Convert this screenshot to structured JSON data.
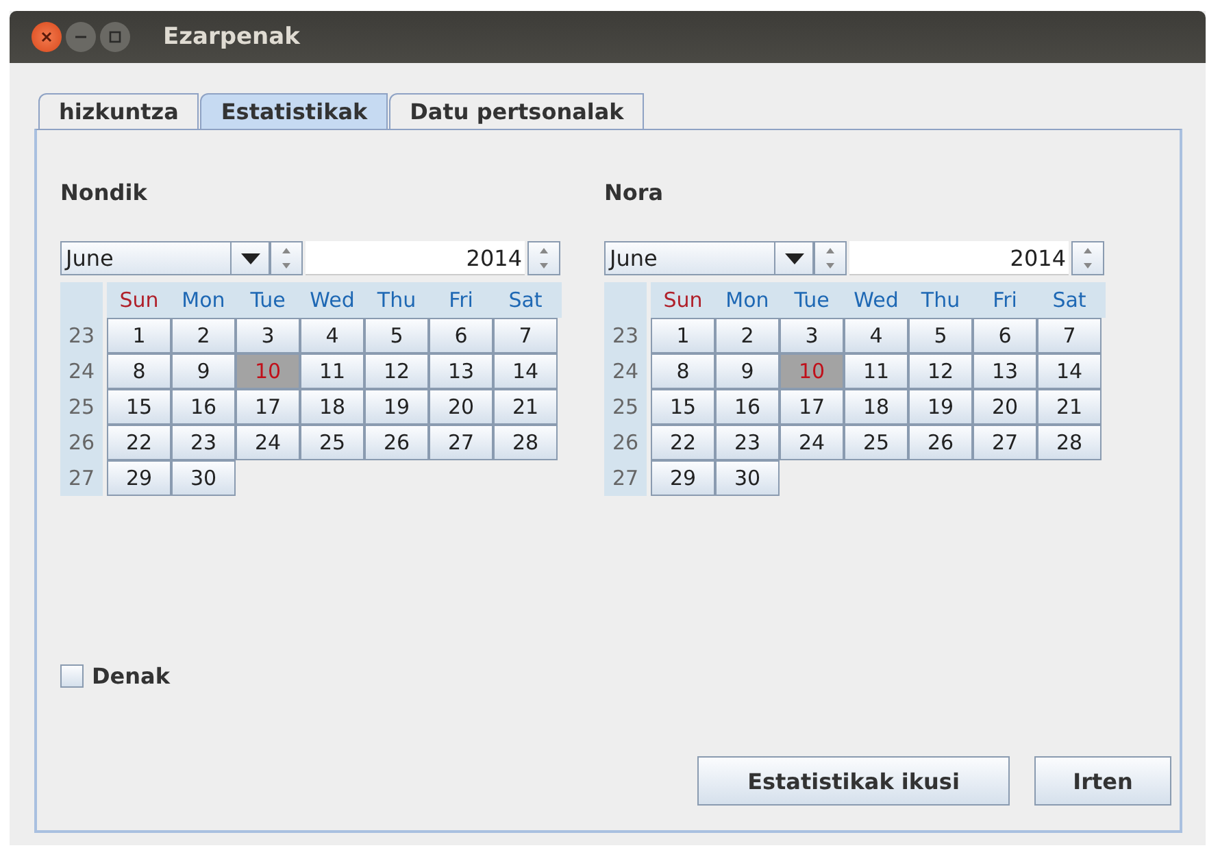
{
  "window": {
    "title": "Ezarpenak"
  },
  "tabs": [
    {
      "label": "hizkuntza",
      "selected": false
    },
    {
      "label": "Estatistikak",
      "selected": true
    },
    {
      "label": "Datu pertsonalak",
      "selected": false
    }
  ],
  "calendars": [
    {
      "title": "Nondik",
      "month": "June",
      "year": "2014",
      "day_names": [
        {
          "label": "Sun",
          "kind": "weekend"
        },
        {
          "label": "Mon",
          "kind": "weekday"
        },
        {
          "label": "Tue",
          "kind": "weekday"
        },
        {
          "label": "Wed",
          "kind": "weekday"
        },
        {
          "label": "Thu",
          "kind": "weekday"
        },
        {
          "label": "Fri",
          "kind": "weekday"
        },
        {
          "label": "Sat",
          "kind": "weekday"
        }
      ],
      "weeks": [
        {
          "week": "23",
          "days": [
            {
              "label": "1",
              "selected": false
            },
            {
              "label": "2",
              "selected": false
            },
            {
              "label": "3",
              "selected": false
            },
            {
              "label": "4",
              "selected": false
            },
            {
              "label": "5",
              "selected": false
            },
            {
              "label": "6",
              "selected": false
            },
            {
              "label": "7",
              "selected": false
            }
          ]
        },
        {
          "week": "24",
          "days": [
            {
              "label": "8",
              "selected": false
            },
            {
              "label": "9",
              "selected": false
            },
            {
              "label": "10",
              "selected": true
            },
            {
              "label": "11",
              "selected": false
            },
            {
              "label": "12",
              "selected": false
            },
            {
              "label": "13",
              "selected": false
            },
            {
              "label": "14",
              "selected": false
            }
          ]
        },
        {
          "week": "25",
          "days": [
            {
              "label": "15",
              "selected": false
            },
            {
              "label": "16",
              "selected": false
            },
            {
              "label": "17",
              "selected": false
            },
            {
              "label": "18",
              "selected": false
            },
            {
              "label": "19",
              "selected": false
            },
            {
              "label": "20",
              "selected": false
            },
            {
              "label": "21",
              "selected": false
            }
          ]
        },
        {
          "week": "26",
          "days": [
            {
              "label": "22",
              "selected": false
            },
            {
              "label": "23",
              "selected": false
            },
            {
              "label": "24",
              "selected": false
            },
            {
              "label": "25",
              "selected": false
            },
            {
              "label": "26",
              "selected": false
            },
            {
              "label": "27",
              "selected": false
            },
            {
              "label": "28",
              "selected": false
            }
          ]
        },
        {
          "week": "27",
          "days": [
            {
              "label": "29",
              "selected": false
            },
            {
              "label": "30",
              "selected": false
            }
          ]
        }
      ]
    },
    {
      "title": "Nora",
      "month": "June",
      "year": "2014",
      "day_names": [
        {
          "label": "Sun",
          "kind": "weekend"
        },
        {
          "label": "Mon",
          "kind": "weekday"
        },
        {
          "label": "Tue",
          "kind": "weekday"
        },
        {
          "label": "Wed",
          "kind": "weekday"
        },
        {
          "label": "Thu",
          "kind": "weekday"
        },
        {
          "label": "Fri",
          "kind": "weekday"
        },
        {
          "label": "Sat",
          "kind": "weekday"
        }
      ],
      "weeks": [
        {
          "week": "23",
          "days": [
            {
              "label": "1",
              "selected": false
            },
            {
              "label": "2",
              "selected": false
            },
            {
              "label": "3",
              "selected": false
            },
            {
              "label": "4",
              "selected": false
            },
            {
              "label": "5",
              "selected": false
            },
            {
              "label": "6",
              "selected": false
            },
            {
              "label": "7",
              "selected": false
            }
          ]
        },
        {
          "week": "24",
          "days": [
            {
              "label": "8",
              "selected": false
            },
            {
              "label": "9",
              "selected": false
            },
            {
              "label": "10",
              "selected": true
            },
            {
              "label": "11",
              "selected": false
            },
            {
              "label": "12",
              "selected": false
            },
            {
              "label": "13",
              "selected": false
            },
            {
              "label": "14",
              "selected": false
            }
          ]
        },
        {
          "week": "25",
          "days": [
            {
              "label": "15",
              "selected": false
            },
            {
              "label": "16",
              "selected": false
            },
            {
              "label": "17",
              "selected": false
            },
            {
              "label": "18",
              "selected": false
            },
            {
              "label": "19",
              "selected": false
            },
            {
              "label": "20",
              "selected": false
            },
            {
              "label": "21",
              "selected": false
            }
          ]
        },
        {
          "week": "26",
          "days": [
            {
              "label": "22",
              "selected": false
            },
            {
              "label": "23",
              "selected": false
            },
            {
              "label": "24",
              "selected": false
            },
            {
              "label": "25",
              "selected": false
            },
            {
              "label": "26",
              "selected": false
            },
            {
              "label": "27",
              "selected": false
            },
            {
              "label": "28",
              "selected": false
            }
          ]
        },
        {
          "week": "27",
          "days": [
            {
              "label": "29",
              "selected": false
            },
            {
              "label": "30",
              "selected": false
            }
          ]
        }
      ]
    }
  ],
  "all_checkbox": {
    "label": "Denak",
    "checked": false
  },
  "buttons": [
    {
      "label": "Estatistikak ikusi"
    },
    {
      "label": "Irten"
    }
  ]
}
